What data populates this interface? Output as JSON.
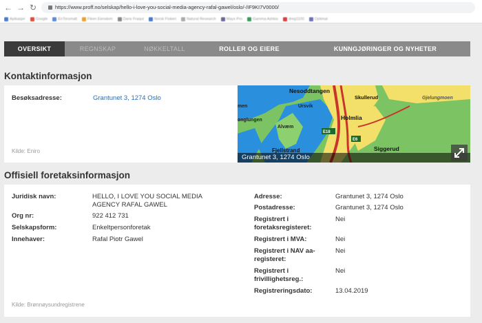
{
  "browser": {
    "url": "https://www.proff.no/selskap/hello-i-love-you-social-media-agency-rafal-gawel/oslo/-/IF9KI7V0000/",
    "bookmarks": [
      {
        "label": "Apikasjer",
        "color": "#4a7bd0"
      },
      {
        "label": "Google",
        "color": "#dd4b39"
      },
      {
        "label": "EnTorsmalt",
        "color": "#5a8bd8"
      },
      {
        "label": "Fiken Eiendom",
        "color": "#f0a030"
      },
      {
        "label": "Dans Fraqut",
        "color": "#888888"
      },
      {
        "label": "Norsk Fiskeri",
        "color": "#4a7bd0"
      },
      {
        "label": "Natural Research",
        "color": "#aaaaaa"
      },
      {
        "label": "Mayx Pro",
        "color": "#6a6a9a"
      },
      {
        "label": "Gamma Ashkis",
        "color": "#3a9a5a"
      },
      {
        "label": "dreg1100",
        "color": "#d84040"
      },
      {
        "label": "Optimal",
        "color": "#7070c0"
      }
    ]
  },
  "tabs": [
    {
      "label": "OVERSIKT"
    },
    {
      "label": "REGNSKAP"
    },
    {
      "label": "NØKKELTALL"
    },
    {
      "label": "ROLLER OG EIERE"
    },
    {
      "label": "KUNNGJØRINGER OG NYHETER"
    }
  ],
  "contact": {
    "title": "Kontaktinformasjon",
    "visit_label": "Besøksadresse:",
    "visit_value": "Grantunet 3, 1274 Oslo",
    "source": "Kilde: Eniro",
    "map": {
      "caption": "Grantunet 3, 1274 Oslo",
      "places": [
        "Nesoddtangen",
        "Skullerud",
        "Ursvik",
        "Holmlia",
        "Alvæm",
        "Fjellstrand",
        "Siggerud",
        "Gjelungmoen",
        "E18",
        "E6",
        "onglungen",
        "men"
      ]
    }
  },
  "official": {
    "title": "Offisiell foretaksinformasjon",
    "left": [
      {
        "label": "Juridisk navn:",
        "value_lines": [
          "HELLO, I LOVE YOU SOCIAL MEDIA",
          "AGENCY RAFAL GAWEL"
        ]
      },
      {
        "label": "Org nr:",
        "value_lines": [
          "922 412 731"
        ]
      },
      {
        "label": "Selskapsform:",
        "value_lines": [
          "Enkeltpersonforetak"
        ]
      },
      {
        "label": "Innehaver:",
        "value_lines": [
          "Rafal Piotr Gawel"
        ]
      }
    ],
    "right": [
      {
        "label_lines": [
          "Adresse:"
        ],
        "value": "Grantunet 3, 1274 Oslo"
      },
      {
        "label_lines": [
          "Postadresse:"
        ],
        "value": "Grantunet 3, 1274 Oslo"
      },
      {
        "label_lines": [
          "Registrert i",
          "foretaksregisteret:"
        ],
        "value": "Nei"
      },
      {
        "label_lines": [
          "Registrert i MVA:"
        ],
        "value": "Nei"
      },
      {
        "label_lines": [
          "Registrert i NAV aa-",
          "registeret:"
        ],
        "value": "Nei"
      },
      {
        "label_lines": [
          "Registrert i",
          "frivillighetsreg.:"
        ],
        "value": "Nei"
      },
      {
        "label_lines": [
          "Registreringsdato:"
        ],
        "value": "13.04.2019"
      }
    ],
    "source": "Kilde: Brønnøysundregistrene"
  }
}
